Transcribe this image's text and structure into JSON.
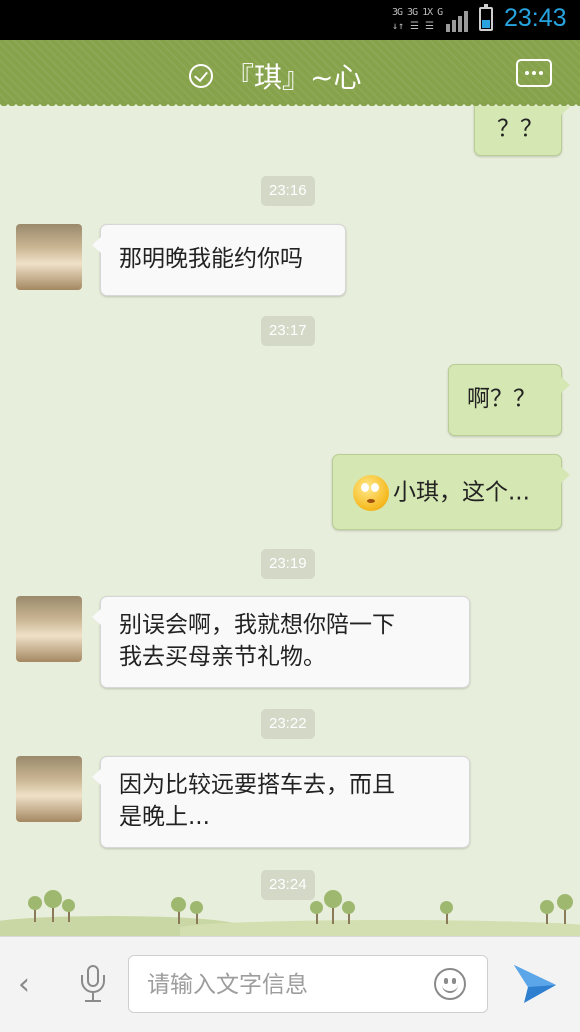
{
  "status_bar": {
    "network_top": "3G 3G 1X G",
    "network_bottom": "↓↑ ☰ ☰",
    "battery_level": 0.3,
    "time": "23:43"
  },
  "header": {
    "title": "『琪』~心",
    "icons": [
      "check-circle-icon",
      "more-menu-icon"
    ]
  },
  "messages": [
    {
      "type": "outgoing",
      "text": "？？"
    },
    {
      "type": "timestamp",
      "text": "23:16"
    },
    {
      "type": "incoming",
      "text": "那明晚我能约你吗"
    },
    {
      "type": "timestamp",
      "text": "23:17"
    },
    {
      "type": "outgoing",
      "text": "啊？？"
    },
    {
      "type": "outgoing",
      "text": "小琪，这个...",
      "emoji": "confused-face-emoji"
    },
    {
      "type": "timestamp",
      "text": "23:19"
    },
    {
      "type": "incoming",
      "text": "别误会啊，我就想你陪一下\n我去买母亲节礼物。"
    },
    {
      "type": "timestamp",
      "text": "23:22"
    },
    {
      "type": "incoming",
      "text": "因为比较远要搭车去，而且\n是晚上..."
    },
    {
      "type": "timestamp",
      "text": "23:24"
    }
  ],
  "input_bar": {
    "placeholder": "请输入文字信息",
    "value": "",
    "icons": [
      "back-chevron-icon",
      "microphone-icon",
      "emoji-icon",
      "send-icon"
    ]
  },
  "colors": {
    "header_bg": "#86a34c",
    "chat_bg": "#e8eedc",
    "outgoing_bubble": "#d5e7b3",
    "incoming_bubble": "#f9f9f9",
    "clock": "#27a4e0"
  }
}
